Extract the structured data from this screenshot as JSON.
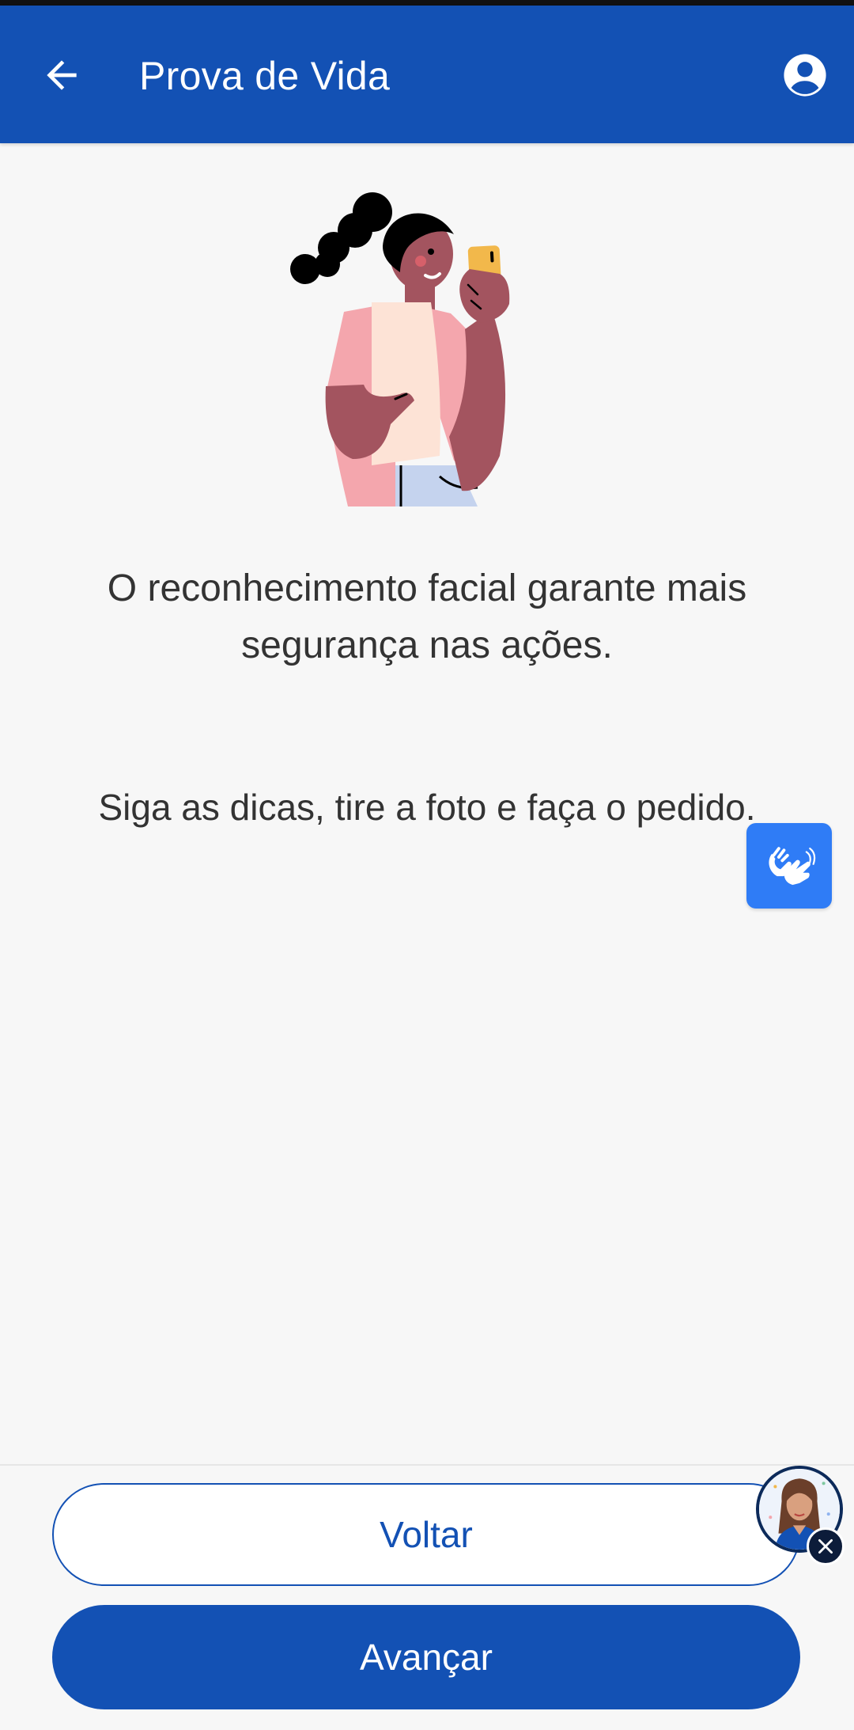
{
  "header": {
    "title": "Prova de Vida",
    "back_icon": "arrow-left-icon",
    "profile_icon": "user-circle-icon"
  },
  "content": {
    "illustration": "woman-holding-phone-illustration",
    "main_text": "O reconhecimento facial garante mais segurança nas ações.",
    "sub_text": "Siga as dicas, tire a foto e faça o pedido."
  },
  "floating": {
    "libras_icon": "sign-language-hands-icon",
    "assistant_icon": "virtual-assistant-avatar",
    "close_icon": "close-icon"
  },
  "actions": {
    "back_label": "Voltar",
    "next_label": "Avançar"
  },
  "colors": {
    "primary": "#1351b4",
    "accent": "#2f7cf6",
    "background": "#f7f7f7",
    "text": "#333333"
  }
}
